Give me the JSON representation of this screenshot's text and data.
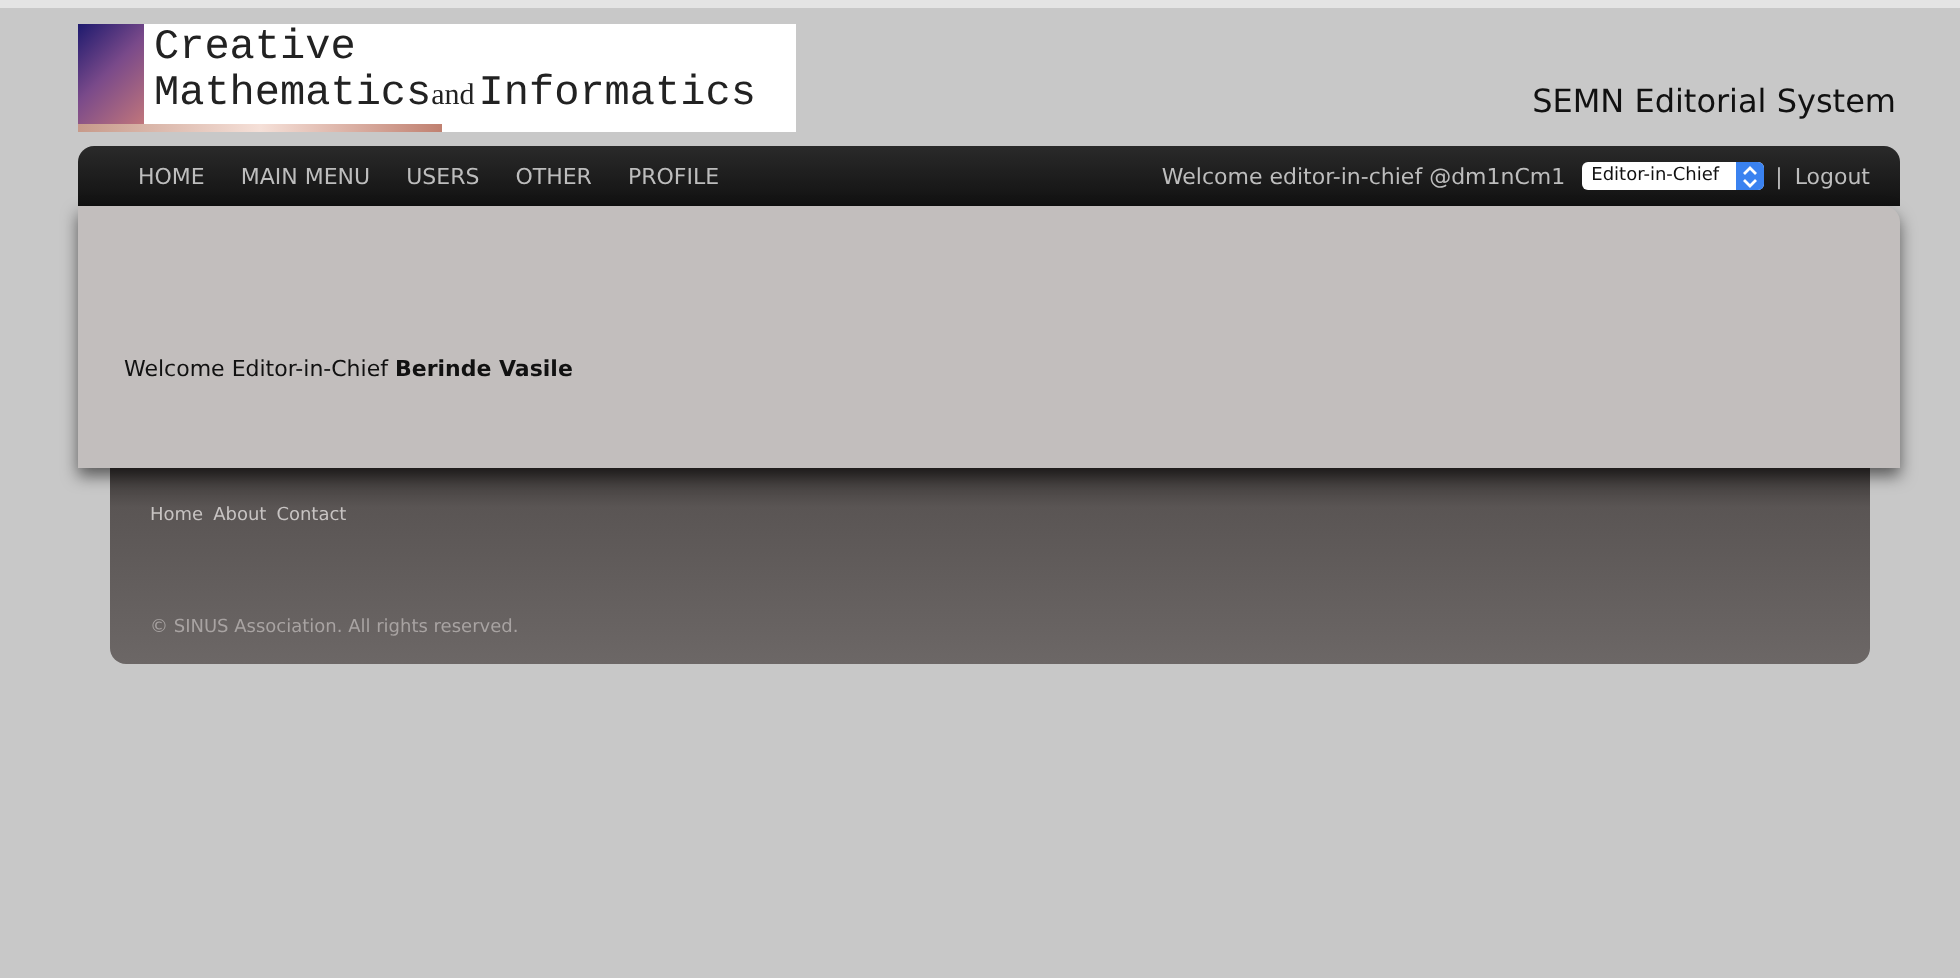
{
  "logo": {
    "line1": "Creative",
    "line2": [
      {
        "kind": "word",
        "text": "Mathematics"
      },
      {
        "kind": "joiner",
        "text": "and"
      },
      {
        "kind": "word",
        "text": "Informatics"
      }
    ]
  },
  "site_title": "SEMN Editorial System",
  "nav": {
    "items": [
      {
        "label": "HOME"
      },
      {
        "label": "MAIN MENU"
      },
      {
        "label": "USERS"
      },
      {
        "label": "OTHER"
      },
      {
        "label": "PROFILE"
      }
    ],
    "welcome": "Welcome editor-in-chief @dm1nCm1",
    "role_select": {
      "value": "Editor-in-Chief"
    },
    "separator": "|",
    "logout": "Logout"
  },
  "content": {
    "message": "Welcome Editor-in-Chief **Berinde Vasile**"
  },
  "footer": {
    "links": [
      {
        "label": "Home"
      },
      {
        "label": "About"
      },
      {
        "label": "Contact"
      }
    ],
    "copyright": "© SINUS Association. All rights reserved."
  }
}
